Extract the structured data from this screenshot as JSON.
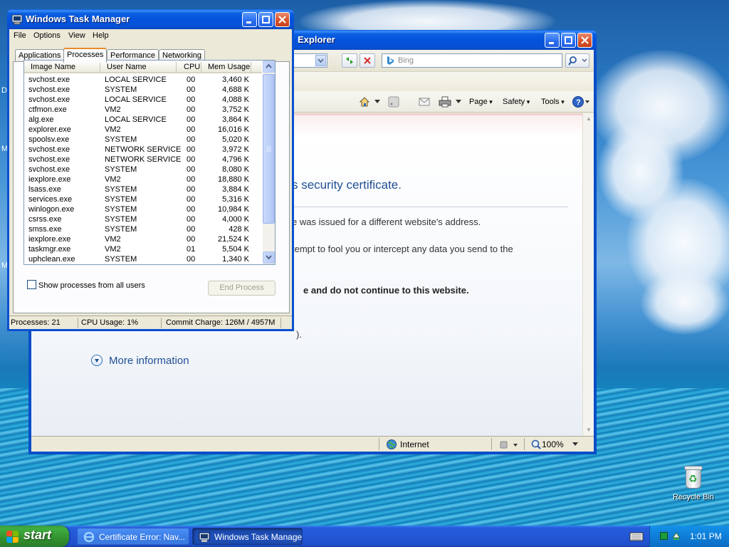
{
  "desktop": {
    "left_icon_letters": [
      "D",
      "M",
      "M"
    ],
    "recycle_bin_label": "Recycle Bin"
  },
  "ie": {
    "title_partial": "Explorer",
    "search_placeholder": "Bing",
    "commands": {
      "page": "Page",
      "safety": "Safety",
      "tools": "Tools"
    },
    "content": {
      "heading_partial": "s security certificate.",
      "line1_partial": "e was issued for a different website's address.",
      "line2_partial": "tempt to fool you or intercept any data you send to the",
      "bold_partial": "e and do not continue to this website.",
      "fragment": ").",
      "more_info": "More information"
    },
    "status": {
      "zone": "Internet",
      "zoom": "100%"
    }
  },
  "task_manager": {
    "title": "Windows Task Manager",
    "menu": [
      "File",
      "Options",
      "View",
      "Help"
    ],
    "tabs": [
      "Applications",
      "Processes",
      "Performance",
      "Networking"
    ],
    "active_tab": "Processes",
    "columns": [
      "Image Name",
      "User Name",
      "CPU",
      "Mem Usage"
    ],
    "processes": [
      {
        "name": "svchost.exe",
        "user": "LOCAL SERVICE",
        "cpu": "00",
        "mem": "3,460 K"
      },
      {
        "name": "svchost.exe",
        "user": "SYSTEM",
        "cpu": "00",
        "mem": "4,688 K"
      },
      {
        "name": "svchost.exe",
        "user": "LOCAL SERVICE",
        "cpu": "00",
        "mem": "4,088 K"
      },
      {
        "name": "ctfmon.exe",
        "user": "VM2",
        "cpu": "00",
        "mem": "3,752 K"
      },
      {
        "name": "alg.exe",
        "user": "LOCAL SERVICE",
        "cpu": "00",
        "mem": "3,864 K"
      },
      {
        "name": "explorer.exe",
        "user": "VM2",
        "cpu": "00",
        "mem": "16,016 K"
      },
      {
        "name": "spoolsv.exe",
        "user": "SYSTEM",
        "cpu": "00",
        "mem": "5,020 K"
      },
      {
        "name": "svchost.exe",
        "user": "NETWORK SERVICE",
        "cpu": "00",
        "mem": "3,972 K"
      },
      {
        "name": "svchost.exe",
        "user": "NETWORK SERVICE",
        "cpu": "00",
        "mem": "4,796 K"
      },
      {
        "name": "svchost.exe",
        "user": "SYSTEM",
        "cpu": "00",
        "mem": "8,080 K"
      },
      {
        "name": "iexplore.exe",
        "user": "VM2",
        "cpu": "00",
        "mem": "18,880 K"
      },
      {
        "name": "lsass.exe",
        "user": "SYSTEM",
        "cpu": "00",
        "mem": "3,884 K"
      },
      {
        "name": "services.exe",
        "user": "SYSTEM",
        "cpu": "00",
        "mem": "5,316 K"
      },
      {
        "name": "winlogon.exe",
        "user": "SYSTEM",
        "cpu": "00",
        "mem": "10,984 K"
      },
      {
        "name": "csrss.exe",
        "user": "SYSTEM",
        "cpu": "00",
        "mem": "4,000 K"
      },
      {
        "name": "smss.exe",
        "user": "SYSTEM",
        "cpu": "00",
        "mem": "428 K"
      },
      {
        "name": "iexplore.exe",
        "user": "VM2",
        "cpu": "00",
        "mem": "21,524 K"
      },
      {
        "name": "taskmgr.exe",
        "user": "VM2",
        "cpu": "01",
        "mem": "5,504 K"
      },
      {
        "name": "uphclean.exe",
        "user": "SYSTEM",
        "cpu": "00",
        "mem": "1,340 K"
      }
    ],
    "show_all_label": "Show processes from all users",
    "end_process_label": "End Process",
    "status": {
      "processes": "Processes: 21",
      "cpu": "CPU Usage: 1%",
      "commit": "Commit Charge: 126M / 4957M"
    }
  },
  "taskbar": {
    "start_label": "start",
    "tasks": [
      "Certificate Error: Nav...",
      "Windows Task Manager"
    ],
    "clock": "1:01 PM"
  }
}
